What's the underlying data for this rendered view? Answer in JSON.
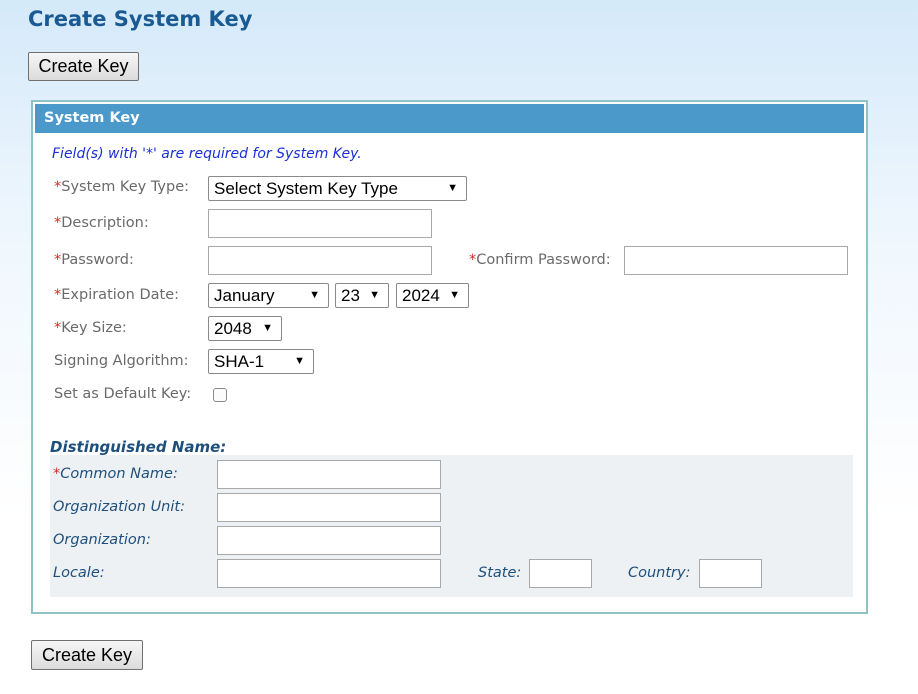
{
  "page": {
    "title": "Create System Key"
  },
  "buttons": {
    "create_key_top": "Create Key",
    "create_key_bottom": "Create Key"
  },
  "panel": {
    "header": "System Key",
    "required_note": "Field(s) with '*' are required for System Key.",
    "required_marker": "*",
    "fields": {
      "key_type": {
        "label": "System Key Type:",
        "value": "Select System Key Type"
      },
      "description": {
        "label": "Description:",
        "value": ""
      },
      "password": {
        "label": "Password:",
        "value": ""
      },
      "confirm_password": {
        "label": "Confirm Password:",
        "value": ""
      },
      "expiration": {
        "label": "Expiration Date:",
        "month": "January",
        "day": "23",
        "year": "2024"
      },
      "key_size": {
        "label": "Key Size:",
        "value": "2048"
      },
      "signing": {
        "label": "Signing Algorithm:",
        "value": "SHA-1"
      },
      "default_key": {
        "label": "Set as Default Key:",
        "checked": false
      }
    },
    "dn": {
      "title": "Distinguished Name:",
      "common_name": {
        "label": "Common Name:",
        "value": ""
      },
      "org_unit": {
        "label": "Organization Unit:",
        "value": ""
      },
      "organization": {
        "label": "Organization:",
        "value": ""
      },
      "locale": {
        "label": "Locale:",
        "value": ""
      },
      "state": {
        "label": "State:",
        "value": ""
      },
      "country": {
        "label": "Country:",
        "value": ""
      }
    }
  },
  "icons": {
    "dropdown": "caret-down-icon",
    "caret_glyph": "▼"
  },
  "colors": {
    "title": "#1a5a93",
    "panel_header": "#4b98cb",
    "required": "#d22a2a",
    "note": "#1a2fd6",
    "dn_text": "#1e4f7c"
  }
}
